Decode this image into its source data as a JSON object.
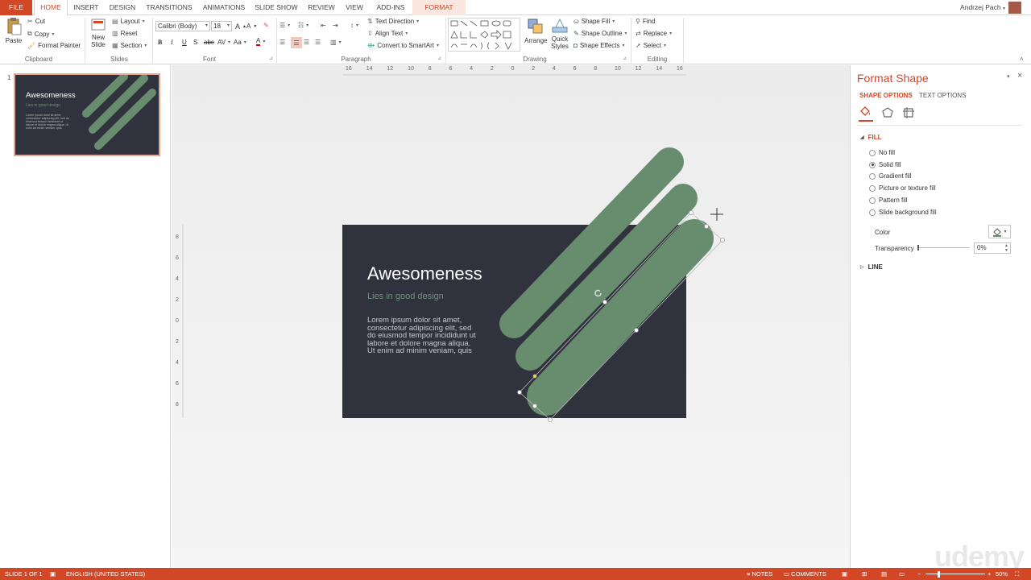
{
  "tabs": [
    "FILE",
    "HOME",
    "INSERT",
    "DESIGN",
    "TRANSITIONS",
    "ANIMATIONS",
    "SLIDE SHOW",
    "REVIEW",
    "VIEW",
    "ADD-INS",
    "FORMAT"
  ],
  "user": {
    "name": "Andrzej Pach"
  },
  "ribbon": {
    "clipboard": {
      "paste": "Paste",
      "cut": "Cut",
      "copy": "Copy",
      "format_painter": "Format Painter",
      "label": "Clipboard"
    },
    "slides": {
      "new_slide_1": "New",
      "new_slide_2": "Slide",
      "layout": "Layout",
      "reset": "Reset",
      "section": "Section",
      "label": "Slides"
    },
    "font": {
      "font_name": "Calibri (Body)",
      "font_size": "18",
      "label": "Font"
    },
    "paragraph": {
      "text_direction": "Text Direction",
      "align_text": "Align Text",
      "convert_smartart": "Convert to SmartArt",
      "label": "Paragraph"
    },
    "drawing": {
      "arrange": "Arrange",
      "quick_styles_1": "Quick",
      "quick_styles_2": "Styles",
      "shape_fill": "Shape Fill",
      "shape_outline": "Shape Outline",
      "shape_effects": "Shape Effects",
      "label": "Drawing"
    },
    "editing": {
      "find": "Find",
      "replace": "Replace",
      "select": "Select",
      "label": "Editing"
    }
  },
  "thumbnail": {
    "number": "1",
    "title": "Awesomeness",
    "subtitle": "Lies in good design",
    "body": "Lorem ipsum dolor sit amet, consectetur adipiscing elit, sed do eiusmod tempor incididunt ut labore et dolore magna aliqua. Ut enim ad minim veniam, quis"
  },
  "rulers": {
    "horizontal": [
      "16",
      "14",
      "12",
      "10",
      "8",
      "6",
      "4",
      "2",
      "0",
      "2",
      "4",
      "6",
      "8",
      "10",
      "12",
      "14",
      "16"
    ],
    "vertical": [
      "8",
      "6",
      "4",
      "2",
      "0",
      "2",
      "4",
      "6",
      "8"
    ]
  },
  "slide": {
    "title": "Awesomeness",
    "subtitle": "Lies in good design",
    "body": "Lorem ipsum dolor sit amet, consectetur adipiscing elit, sed do eiusmod tempor incididunt ut labore et dolore magna aliqua. Ut enim ad minim veniam, quis"
  },
  "format_pane": {
    "title": "Format Shape",
    "tab_shape": "SHAPE OPTIONS",
    "tab_text": "TEXT OPTIONS",
    "fill_section": "FILL",
    "fill_options": [
      {
        "label": "No fill",
        "selected": false
      },
      {
        "label": "Solid fill",
        "selected": true
      },
      {
        "label": "Gradient fill",
        "selected": false
      },
      {
        "label": "Picture or texture fill",
        "selected": false
      },
      {
        "label": "Pattern fill",
        "selected": false
      },
      {
        "label": "Slide background fill",
        "selected": false
      }
    ],
    "color_label": "Color",
    "transparency_label": "Transparency",
    "transparency_value": "0%",
    "line_section": "LINE"
  },
  "status": {
    "slide_info": "SLIDE 1 OF 1",
    "language": "ENGLISH (UNITED STATES)",
    "notes": "NOTES",
    "comments": "COMMENTS",
    "zoom": "50%"
  },
  "watermark": "udemy",
  "colors": {
    "accent": "#d24726",
    "slide_bg": "#30323d",
    "shape_fill": "#678c6e",
    "subtitle": "#6a9477"
  }
}
